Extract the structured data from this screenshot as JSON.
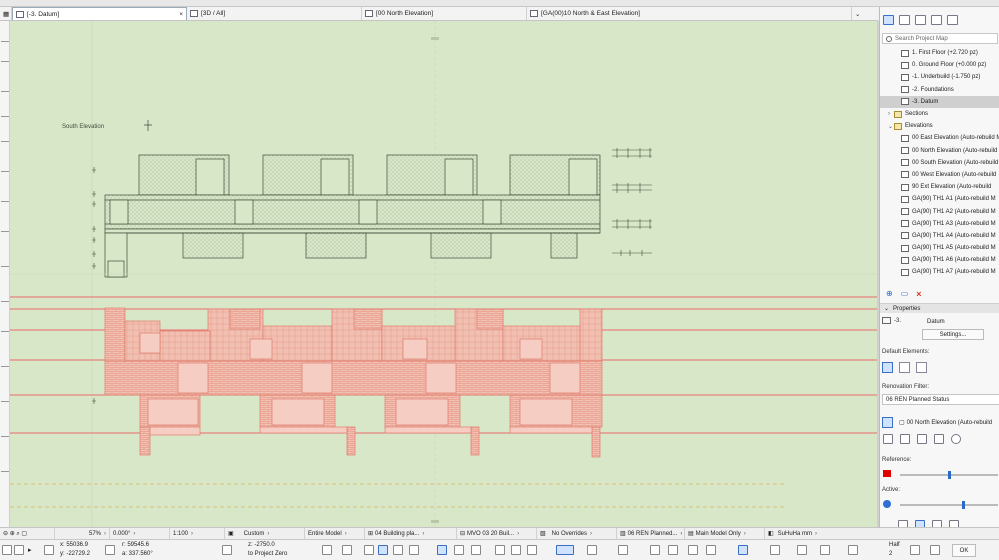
{
  "tabs": [
    {
      "label": "[-3. Datum]",
      "active": true
    },
    {
      "label": "[3D / All]",
      "active": false
    },
    {
      "label": "[00 North Elevation]",
      "active": false
    },
    {
      "label": "[GA(00)10 North & East Elevation]",
      "active": false
    }
  ],
  "canvas": {
    "drawing_label": "South Elevation"
  },
  "project_map": {
    "search_placeholder": "Search Project Map",
    "items": [
      {
        "label": "1. First Floor (+2.720 pz)",
        "level": 2,
        "selected": false,
        "folder": false
      },
      {
        "label": "0. Ground Floor (+0.000 pz)",
        "level": 2,
        "selected": false,
        "folder": false
      },
      {
        "label": "-1. Underbuild (-1.750 pz)",
        "level": 2,
        "selected": false,
        "folder": false
      },
      {
        "label": "-2. Foundations",
        "level": 2,
        "selected": false,
        "folder": false
      },
      {
        "label": "-3. Datum",
        "level": 2,
        "selected": true,
        "folder": false
      },
      {
        "label": "Sections",
        "level": 1,
        "selected": false,
        "folder": true,
        "caret": "›"
      },
      {
        "label": "Elevations",
        "level": 1,
        "selected": false,
        "folder": true,
        "caret": "⌄"
      },
      {
        "label": "00 East Elevation (Auto-rebuild M",
        "level": 2,
        "selected": false,
        "folder": false
      },
      {
        "label": "00 North Elevation (Auto-rebuild",
        "level": 2,
        "selected": false,
        "folder": false
      },
      {
        "label": "00 South Elevation (Auto-rebuild",
        "level": 2,
        "selected": false,
        "folder": false
      },
      {
        "label": "00 West Elevation (Auto-rebuild",
        "level": 2,
        "selected": false,
        "folder": false
      },
      {
        "label": "90 Ext Elevation (Auto-rebuild",
        "level": 2,
        "selected": false,
        "folder": false
      },
      {
        "label": "GA(90) TH1 A1 (Auto-rebuild M",
        "level": 2,
        "selected": false,
        "folder": false
      },
      {
        "label": "GA(90) TH1 A2 (Auto-rebuild M",
        "level": 2,
        "selected": false,
        "folder": false
      },
      {
        "label": "GA(90) TH1 A3 (Auto-rebuild M",
        "level": 2,
        "selected": false,
        "folder": false
      },
      {
        "label": "GA(90) TH1 A4 (Auto-rebuild M",
        "level": 2,
        "selected": false,
        "folder": false
      },
      {
        "label": "GA(90) TH1 A5 (Auto-rebuild M",
        "level": 2,
        "selected": false,
        "folder": false
      },
      {
        "label": "GA(90) TH1 A6 (Auto-rebuild M",
        "level": 2,
        "selected": false,
        "folder": false
      },
      {
        "label": "GA(90) TH1 A7 (Auto-rebuild M",
        "level": 2,
        "selected": false,
        "folder": false
      }
    ]
  },
  "properties": {
    "header": "Properties",
    "id_value": "-3.",
    "name_value": "Datum",
    "settings_label": "Settings...",
    "default_elements_label": "Default Elements:",
    "renovation_filter_label": "Renovation Filter:",
    "renovation_filter_value": "06 REN Planned Status",
    "view_value": "00 North Elevation (Auto-rebuild",
    "reference_label": "Reference:",
    "active_label": "Active:",
    "ok_label": "OK",
    "reference_color": "#e00000",
    "active_color": "#2d6fd6"
  },
  "status_bar": {
    "zoom": "57%",
    "angle": "0.000°",
    "scale": "1:100",
    "layer_combo": "Custom",
    "model_filter": "Entire Model",
    "pen_set": "04 Building pla...",
    "model_view": "MVO 03 20 Buil...",
    "overrides": "No Overrides",
    "renovation": "06 REN Planned...",
    "model_only": "Main Model Only",
    "dimension": "SuHuHa mm"
  },
  "coords": {
    "x": "x: 55036.9",
    "y": "y: -22729.2",
    "r": "r: 59545.6",
    "a": "a: 337.560°",
    "z": "z: -2750.0",
    "z_ref": "to Project Zero",
    "snap_half": "Half",
    "snap_value": "2"
  },
  "colors": {
    "canvas_bg": "#d9e7c9",
    "upper_stroke": "#3d4a37",
    "lower_stroke": "#e07b6b",
    "lower_fill": "#efb6a8",
    "level_line": "#ea6a6a",
    "dash_line": "#d7c273"
  }
}
